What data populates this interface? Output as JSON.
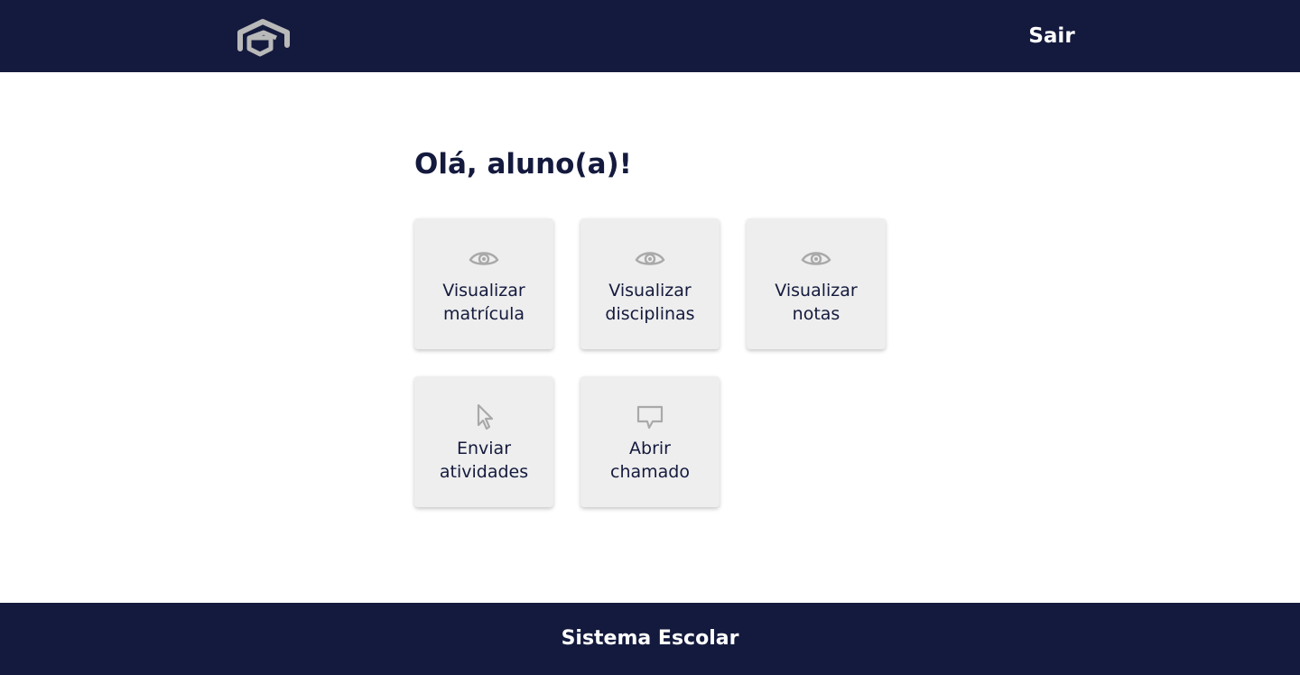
{
  "header": {
    "logo_icon": "graduation-cap-icon",
    "logout_label": "Sair"
  },
  "main": {
    "greeting": "Olá, aluno(a)!",
    "cards": [
      {
        "icon": "eye-icon",
        "line1": "Visualizar",
        "line2": "matrícula"
      },
      {
        "icon": "eye-icon",
        "line1": "Visualizar",
        "line2": "disciplinas"
      },
      {
        "icon": "eye-icon",
        "line1": "Visualizar",
        "line2": "notas"
      },
      {
        "icon": "cursor-pointer-icon",
        "line1": "Enviar",
        "line2": "atividades"
      },
      {
        "icon": "chat-bubble-icon",
        "line1": "Abrir",
        "line2": "chamado"
      }
    ]
  },
  "footer": {
    "title": "Sistema Escolar"
  },
  "colors": {
    "navy": "#141a3d",
    "card_bg": "#eeeeee",
    "icon_gray": "#a9a9a9",
    "text_white": "#ffffff"
  }
}
